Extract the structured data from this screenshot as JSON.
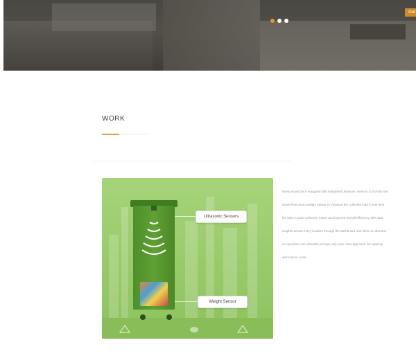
{
  "hero": {
    "cta_label": "Get",
    "slide_count": 3,
    "active_slide": 1
  },
  "section": {
    "title": "WORK"
  },
  "illustration": {
    "ultrasonic_label": "Ultrasonic Sensors",
    "weight_label": "Weight Sensor"
  },
  "description": {
    "lines": [
      "Every smart bin is equipped with integrated ultrasonic sensors to monitor the",
      "waste level and a weight sensor to measure the collected load in real time",
      "for cities to plan collection routes and improve overall efficiency with data",
      "insights across every location through the dashboard and alerts on demand",
      "so operators can schedule pickups only when bins approach full capacity",
      "and reduce costs."
    ]
  },
  "colors": {
    "accent": "#e0a33c",
    "card_green": "#a6d47a",
    "bin_green": "#5fa133"
  }
}
